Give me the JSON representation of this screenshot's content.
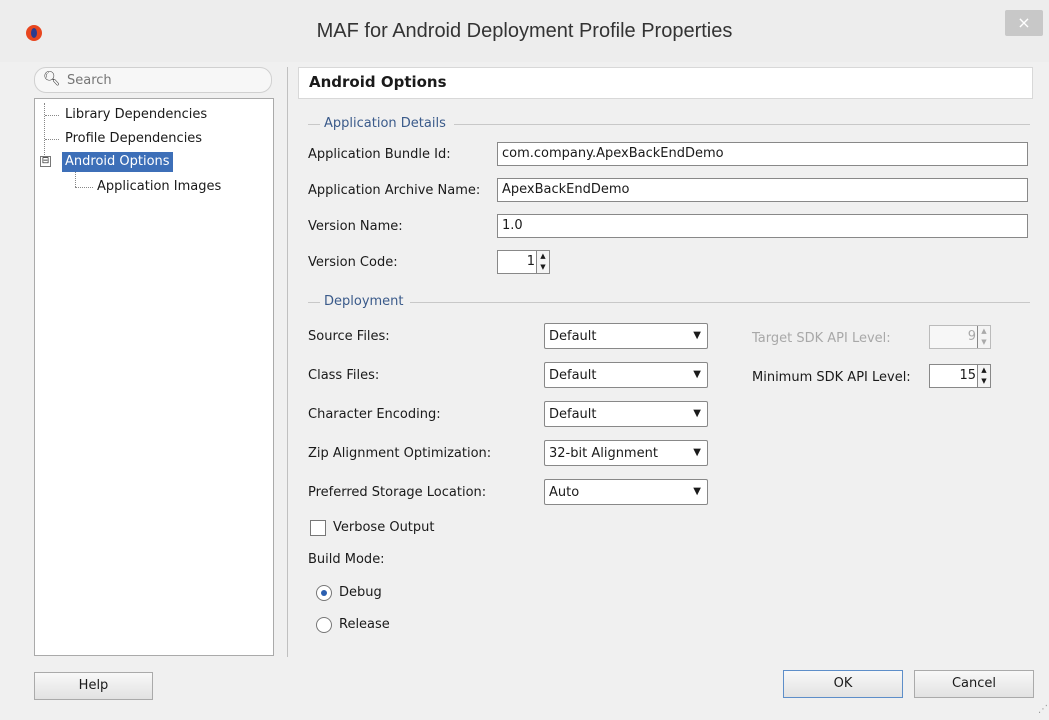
{
  "window": {
    "title": "MAF for Android Deployment Profile Properties",
    "close_label": "×",
    "app_icon": "oracle-logo-icon"
  },
  "search": {
    "placeholder": "Search"
  },
  "tree": {
    "items": [
      {
        "label": "Library Dependencies"
      },
      {
        "label": "Profile Dependencies"
      },
      {
        "label": "Android Options",
        "selected": true
      },
      {
        "label": "Application Images"
      }
    ],
    "expander": "⊟"
  },
  "main": {
    "header": "Android Options",
    "application_details": {
      "group_label": "Application Details",
      "bundle_id_label": "Application Bundle Id:",
      "bundle_id_value": "com.company.ApexBackEndDemo",
      "archive_name_label": "Application Archive Name:",
      "archive_name_value": "ApexBackEndDemo",
      "version_name_label": "Version Name:",
      "version_name_value": "1.0",
      "version_code_label": "Version Code:",
      "version_code_value": "1"
    },
    "deployment": {
      "group_label": "Deployment",
      "source_files_label": "Source Files:",
      "source_files_value": "Default",
      "class_files_label": "Class Files:",
      "class_files_value": "Default",
      "char_encoding_label": "Character Encoding:",
      "char_encoding_value": "Default",
      "zip_align_label": "Zip Alignment Optimization:",
      "zip_align_value": "32-bit Alignment",
      "storage_label": "Preferred Storage Location:",
      "storage_value": "Auto",
      "target_sdk_label": "Target SDK API Level:",
      "target_sdk_value": "9",
      "min_sdk_label": "Minimum SDK API Level:",
      "min_sdk_value": "15",
      "verbose_label": "Verbose Output",
      "verbose_checked": false,
      "build_mode_label": "Build Mode:",
      "debug_label": "Debug",
      "release_label": "Release",
      "build_mode_selected": "Debug"
    }
  },
  "footer": {
    "help_label": "Help",
    "ok_label": "OK",
    "cancel_label": "Cancel"
  }
}
